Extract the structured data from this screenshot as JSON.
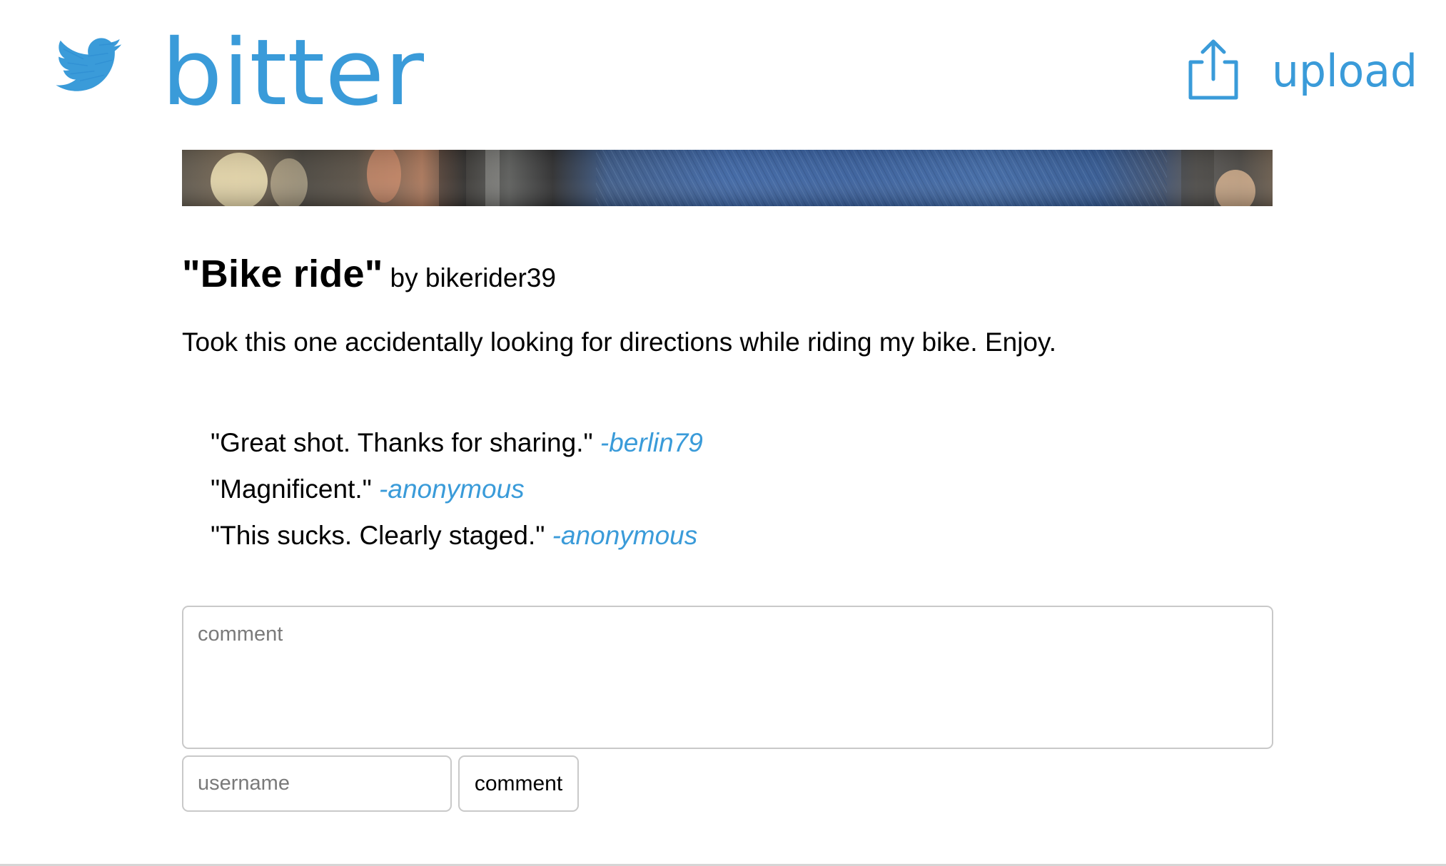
{
  "header": {
    "logo_icon": "bird-icon",
    "brand_name": "bitter",
    "upload_label": "upload",
    "upload_icon": "share-upload-icon",
    "accent_color": "#3a9bd9"
  },
  "post": {
    "title": "\"Bike ride\"",
    "author": "by bikerider39",
    "caption": "Took this one accidentally looking for directions while riding my bike. Enjoy.",
    "comments": [
      {
        "text": "\"Great shot. Thanks for sharing.\"",
        "user": "-berlin79"
      },
      {
        "text": "\"Magnificent.\"",
        "user": "-anonymous"
      },
      {
        "text": "\"This sucks. Clearly staged.\"",
        "user": "-anonymous"
      }
    ]
  },
  "comment_form": {
    "comment_placeholder": "comment",
    "comment_value": "",
    "username_placeholder": "username",
    "username_value": "",
    "submit_label": "comment"
  }
}
